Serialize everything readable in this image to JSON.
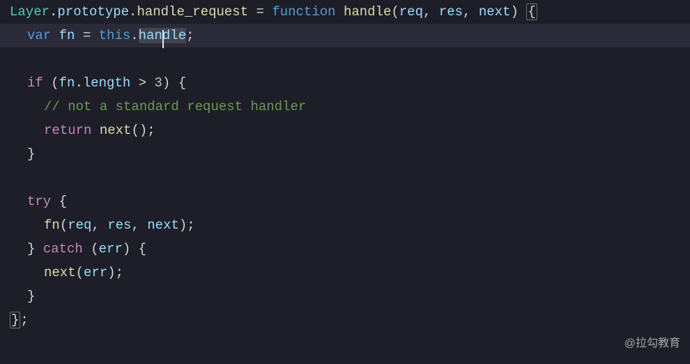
{
  "watermark": "@拉勾教育",
  "code": {
    "line1": {
      "Layer": "Layer",
      "dot1": ".",
      "prototype": "prototype",
      "dot2": ".",
      "handle_request": "handle_request",
      "eq": " = ",
      "function": "function",
      "sp": " ",
      "handle": "handle",
      "lp": "(",
      "req": "req",
      "c1": ", ",
      "res": "res",
      "c2": ", ",
      "next": "next",
      "rp": ")",
      "sp2": " ",
      "lb": "{"
    },
    "line2": {
      "var": "var",
      "sp": " ",
      "fn": "fn",
      "eq": " = ",
      "this": "this",
      "dot": ".",
      "han": "han",
      "dle": "dle",
      "semi": ";"
    },
    "line4": {
      "if": "if",
      "sp": " ",
      "lp": "(",
      "fn": "fn",
      "dot": ".",
      "length": "length",
      "gt": " > ",
      "three": "3",
      "rp": ")",
      "sp2": " ",
      "lb": "{"
    },
    "line5": {
      "comment": "// not a standard request handler"
    },
    "line6": {
      "return": "return",
      "sp": " ",
      "next": "next",
      "lp": "(",
      "rp": ")",
      "semi": ";"
    },
    "line7": {
      "rb": "}"
    },
    "line9": {
      "try": "try",
      "sp": " ",
      "lb": "{"
    },
    "line10": {
      "fn": "fn",
      "lp": "(",
      "req": "req",
      "c1": ", ",
      "res": "res",
      "c2": ", ",
      "next": "next",
      "rp": ")",
      "semi": ";"
    },
    "line11": {
      "rb": "}",
      "sp": " ",
      "catch": "catch",
      "sp2": " ",
      "lp": "(",
      "err": "err",
      "rp": ")",
      "sp3": " ",
      "lb": "{"
    },
    "line12": {
      "next": "next",
      "lp": "(",
      "err": "err",
      "rp": ")",
      "semi": ";"
    },
    "line13": {
      "rb": "}"
    },
    "line14": {
      "rb": "}",
      "semi": ";"
    }
  }
}
